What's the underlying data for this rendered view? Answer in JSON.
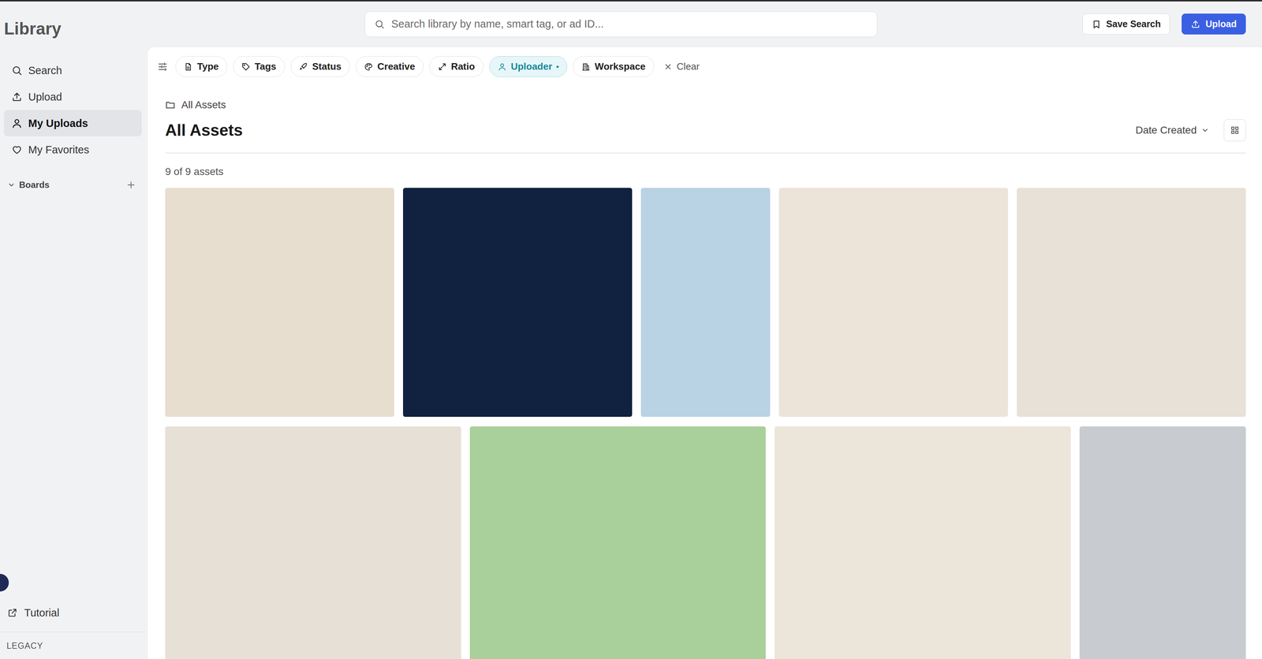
{
  "sidebar": {
    "title": "Library",
    "items": [
      {
        "label": "Search",
        "selected": false
      },
      {
        "label": "Upload",
        "selected": false
      },
      {
        "label": "My Uploads",
        "selected": true
      },
      {
        "label": "My Favorites",
        "selected": false
      }
    ],
    "boards": {
      "label": "Boards",
      "expanded": true
    },
    "tutorial": "Tutorial",
    "footer": "LEGACY"
  },
  "topbar": {
    "search": {
      "placeholder": "Search library by name, smart tag, or ad ID..."
    },
    "buttons": [
      {
        "label": "Save Search",
        "kind": "secondary"
      },
      {
        "label": "Upload",
        "kind": "primary"
      }
    ]
  },
  "filters": [
    {
      "label": "Type",
      "active": false
    },
    {
      "label": "Tags",
      "active": false
    },
    {
      "label": "Status",
      "active": false
    },
    {
      "label": "Creative",
      "active": false
    },
    {
      "label": "Ratio",
      "active": false
    },
    {
      "label": "Uploader",
      "active": true
    },
    {
      "label": "Workspace",
      "active": false
    }
  ],
  "clear": "Clear",
  "breadcrumb": "All Assets",
  "heading": "All Assets",
  "sort": "Date Created",
  "count": "9 of 9 assets",
  "assets": [
    {
      "kind": "square",
      "color": "#e7ded0"
    },
    {
      "kind": "square",
      "color": "#10223f"
    },
    {
      "kind": "portrait",
      "color": "#b9d3e4"
    },
    {
      "kind": "square",
      "color": "#ece4d9"
    },
    {
      "kind": "square",
      "color": "#e8e1d7"
    },
    {
      "kind": "square",
      "color": "#e6e0d6"
    },
    {
      "kind": "square",
      "color": "#a9d09b"
    },
    {
      "kind": "square",
      "color": "#ebe5da"
    },
    {
      "kind": "portrait",
      "color": "#c8ccd1"
    }
  ]
}
